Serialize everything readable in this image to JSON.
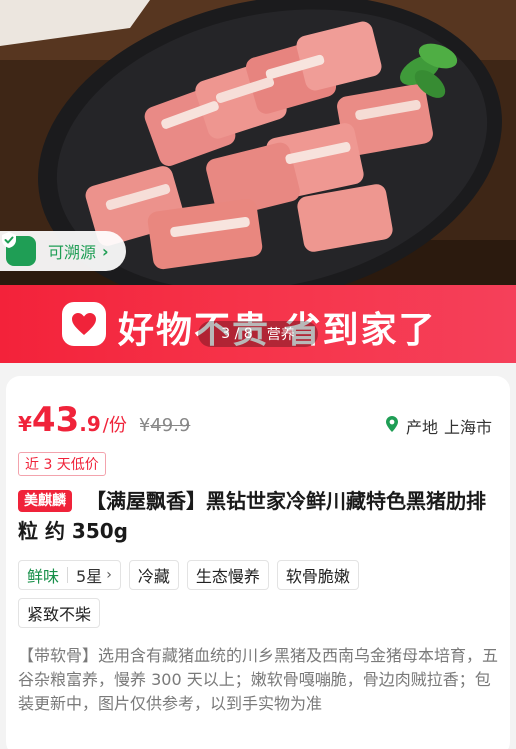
{
  "hero": {
    "trace_label": "可溯源",
    "trace_chevron": "›"
  },
  "banner": {
    "slogan": "好物不贵 省到家了"
  },
  "pager": {
    "index": "3 / 8",
    "mode": "营养"
  },
  "price": {
    "currency": "¥",
    "integer": "43",
    "decimal": ".9",
    "unit": "/份",
    "original_currency": "¥",
    "original": "49.9"
  },
  "origin": {
    "label": "产地",
    "value": "上海市"
  },
  "low_price_tag": "近 3 天低价",
  "product": {
    "brand_tag": "美麒麟",
    "title": "【满屋飘香】黑钻世家冷鲜川藏特色黑猪肋排粒 约 350g"
  },
  "attributes": {
    "taste_label": "鲜味",
    "taste_value": "5星",
    "taste_arrow": "›",
    "tags": [
      "冷藏",
      "生态慢养",
      "软骨脆嫩",
      "紧致不柴"
    ]
  },
  "description": "【带软骨】选用含有藏猪血统的川乡黑猪及西南乌金猪母本培育，五谷杂粮富养，慢养 300 天以上；嫩软骨嘎嘣脆，骨边肉贼拉香；包装更新中，图片仅供参考，以到手实物为准",
  "colors": {
    "accent_red": "#f0233a",
    "trace_green": "#1f9e55"
  },
  "icons": [
    "shield-check-icon",
    "heart-icon",
    "location-pin-icon",
    "chevron-right-icon"
  ]
}
